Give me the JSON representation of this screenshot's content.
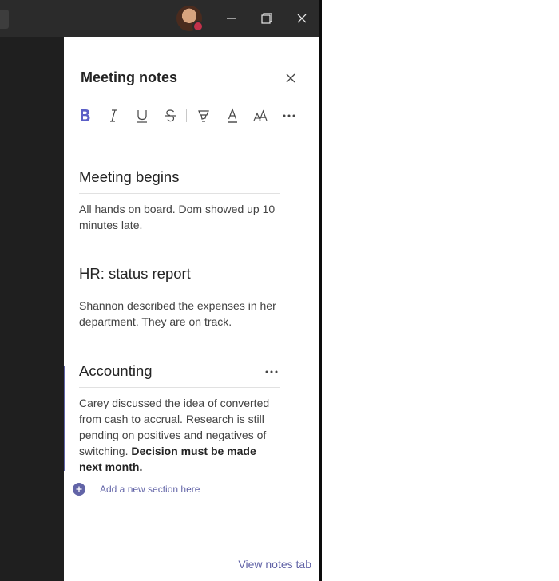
{
  "window": {
    "minimize_icon": "minimize-icon",
    "maximize_icon": "restore-icon",
    "close_icon": "close-icon",
    "presence_color": "#c4314b"
  },
  "panel": {
    "title": "Meeting notes",
    "close_icon": "close-icon"
  },
  "toolbar": {
    "items": [
      "bold-icon",
      "italic-icon",
      "underline-icon",
      "strikethrough-icon",
      "highlight-icon",
      "font-color-icon",
      "font-size-icon",
      "more-options-icon"
    ]
  },
  "sections": [
    {
      "title": "Meeting begins",
      "body": "All hands on board. Dom showed up 10 minutes late."
    },
    {
      "title": "HR: status report",
      "body": "Shannon described the expenses in her department. They are on track."
    },
    {
      "title": "Accounting",
      "body": "Carey discussed the idea of converted from cash to accrual. Research is still pending on positives and negatives of switching.",
      "body_bold": "Decision must be made next month."
    }
  ],
  "add_section": {
    "label": "Add a new section here"
  },
  "footer": {
    "view_notes_tab": "View notes tab"
  },
  "colors": {
    "accent": "#6264a7",
    "dark_bg": "#1f1f1f",
    "titlebar_bg": "#2b2b2b"
  }
}
